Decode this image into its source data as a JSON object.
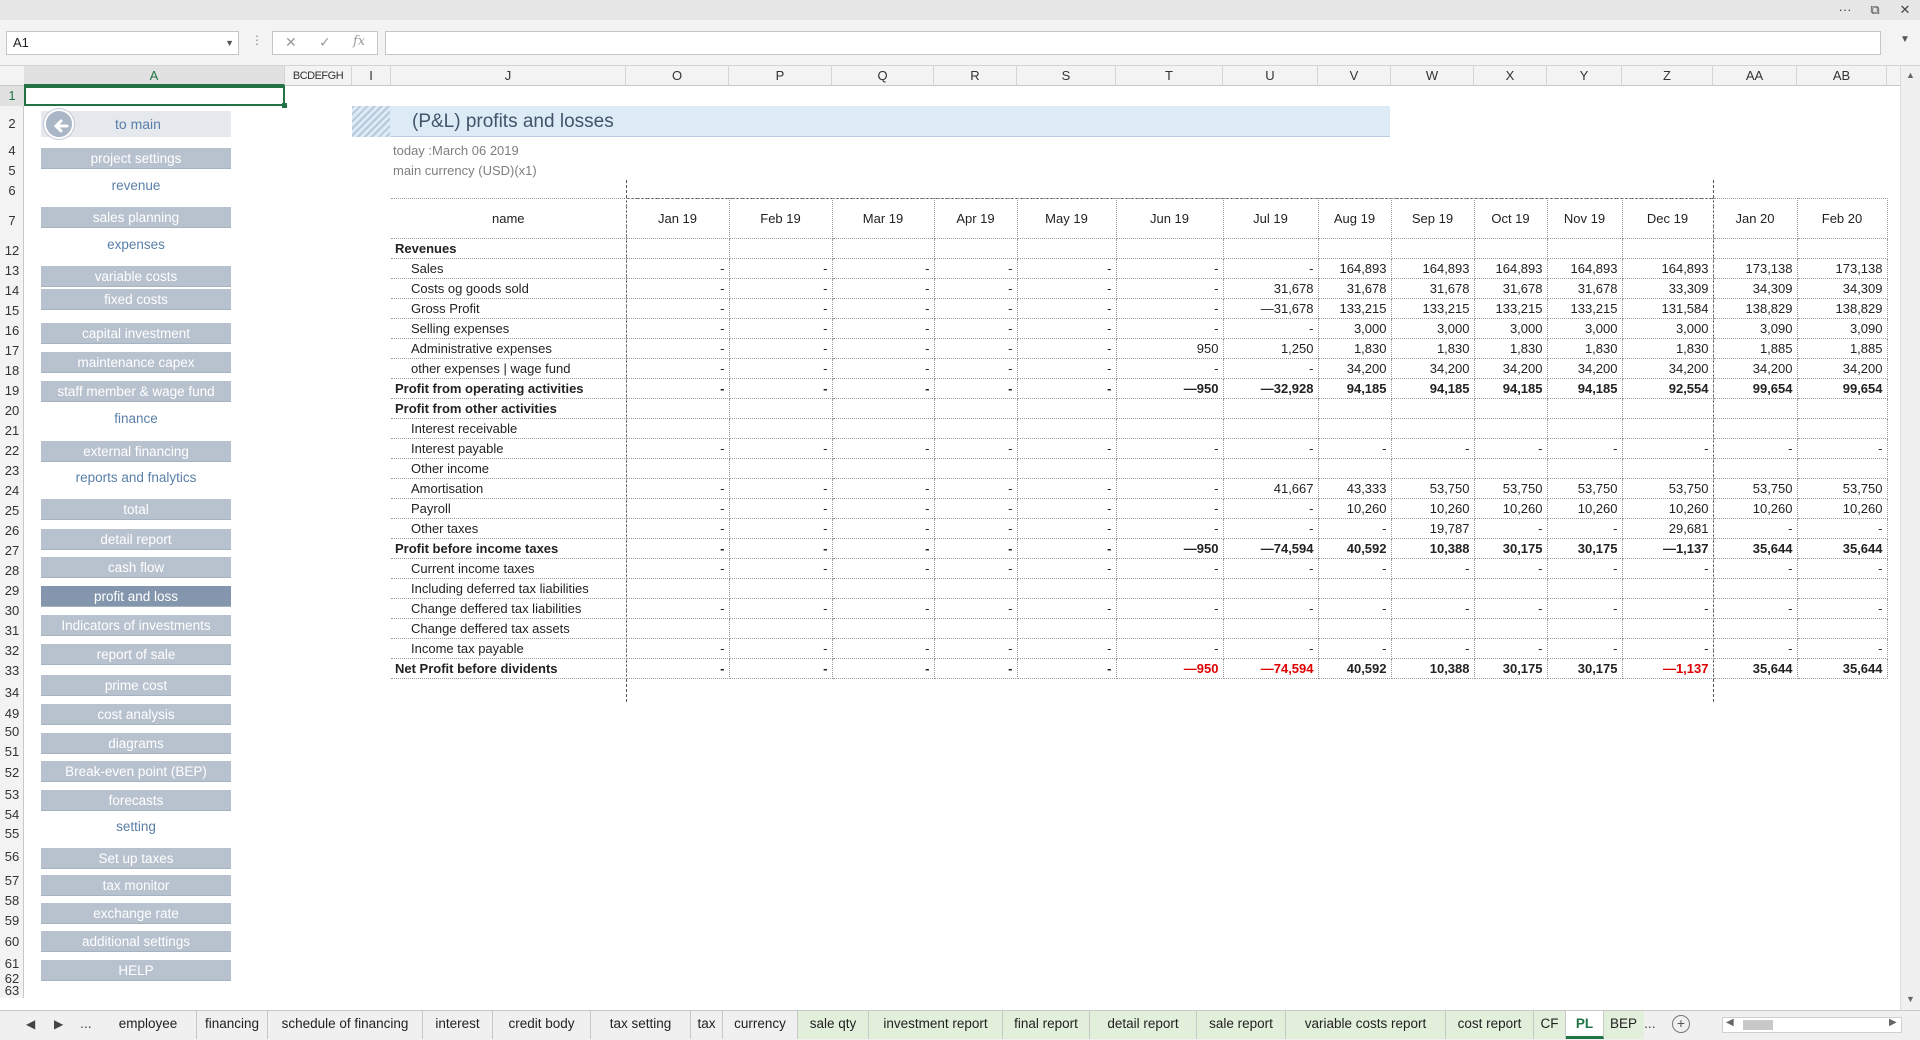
{
  "window": {
    "more": "···",
    "restore": "⧉",
    "close": "✕"
  },
  "formula_bar": {
    "name_box": "A1",
    "cancel": "✕",
    "enter": "✓",
    "fx": "fx",
    "value": ""
  },
  "columns": [
    "A",
    "BCDEFGH",
    "I",
    "J",
    "O",
    "P",
    "Q",
    "R",
    "S",
    "T",
    "U",
    "V",
    "W",
    "X",
    "Y",
    "Z",
    "AA",
    "AB"
  ],
  "rows": [
    "1",
    "2",
    "4",
    "5",
    "6",
    "7",
    "12",
    "13",
    "14",
    "15",
    "16",
    "17",
    "18",
    "19",
    "20",
    "21",
    "22",
    "23",
    "24",
    "25",
    "26",
    "27",
    "28",
    "29",
    "30",
    "31",
    "32",
    "33",
    "34",
    "49",
    "50",
    "51",
    "52",
    "53",
    "54",
    "55",
    "56",
    "57",
    "58",
    "59",
    "60",
    "61",
    "62",
    "63"
  ],
  "sidebar": {
    "to_main": "to main",
    "items": [
      {
        "type": "button",
        "label": "project settings"
      },
      {
        "type": "label",
        "label": "revenue"
      },
      {
        "type": "button",
        "label": "sales planning"
      },
      {
        "type": "label",
        "label": "expenses"
      },
      {
        "type": "button",
        "label": "variable costs"
      },
      {
        "type": "button",
        "label": "fixed costs"
      },
      {
        "type": "button",
        "label": "capital investment"
      },
      {
        "type": "button",
        "label": "maintenance capex"
      },
      {
        "type": "button",
        "label": "staff member & wage fund"
      },
      {
        "type": "label",
        "label": "finance"
      },
      {
        "type": "button",
        "label": "external financing"
      },
      {
        "type": "label",
        "label": "reports and fnalytics"
      },
      {
        "type": "button",
        "label": "total"
      },
      {
        "type": "button",
        "label": "detail report"
      },
      {
        "type": "button",
        "label": "cash flow"
      },
      {
        "type": "button",
        "label": "profit and loss",
        "active": true
      },
      {
        "type": "button",
        "label": "Indicators of investments"
      },
      {
        "type": "button",
        "label": "report of sale"
      },
      {
        "type": "button",
        "label": "prime cost"
      },
      {
        "type": "button",
        "label": "cost analysis"
      },
      {
        "type": "button",
        "label": "diagrams"
      },
      {
        "type": "button",
        "label": "Break-even point (BEP)"
      },
      {
        "type": "button",
        "label": "forecasts"
      },
      {
        "type": "label",
        "label": "setting"
      },
      {
        "type": "button",
        "label": "Set up taxes"
      },
      {
        "type": "button",
        "label": "tax monitor"
      },
      {
        "type": "button",
        "label": "exchange rate"
      },
      {
        "type": "button",
        "label": "additional settings"
      },
      {
        "type": "button",
        "label": "HELP"
      }
    ]
  },
  "report": {
    "title": "(P&L) profits and losses",
    "today": "today :March 06 2019",
    "currency": "main currency (USD)(x1)",
    "name_header": "name",
    "months": [
      "Jan 19",
      "Feb 19",
      "Mar 19",
      "Apr 19",
      "May 19",
      "Jun 19",
      "Jul 19",
      "Aug 19",
      "Sep 19",
      "Oct 19",
      "Nov 19",
      "Dec 19",
      "Jan 20",
      "Feb 20"
    ],
    "rows": [
      {
        "name": "Revenues",
        "style": "bold",
        "values": [
          "",
          "",
          "",
          "",
          "",
          "",
          "",
          "",
          "",
          "",
          "",
          "",
          "",
          ""
        ]
      },
      {
        "name": "Sales",
        "style": "indent",
        "values": [
          "-",
          "-",
          "-",
          "-",
          "-",
          "-",
          "-",
          "164,893",
          "164,893",
          "164,893",
          "164,893",
          "164,893",
          "173,138",
          "173,138"
        ]
      },
      {
        "name": "Costs og goods sold",
        "style": "indent",
        "values": [
          "-",
          "-",
          "-",
          "-",
          "-",
          "-",
          "31,678",
          "31,678",
          "31,678",
          "31,678",
          "31,678",
          "33,309",
          "34,309",
          "34,309"
        ]
      },
      {
        "name": "Gross Profit",
        "style": "indent",
        "values": [
          "-",
          "-",
          "-",
          "-",
          "-",
          "-",
          "—31,678",
          "133,215",
          "133,215",
          "133,215",
          "133,215",
          "131,584",
          "138,829",
          "138,829"
        ]
      },
      {
        "name": "Selling expenses",
        "style": "indent",
        "values": [
          "-",
          "-",
          "-",
          "-",
          "-",
          "-",
          "-",
          "3,000",
          "3,000",
          "3,000",
          "3,000",
          "3,000",
          "3,090",
          "3,090"
        ]
      },
      {
        "name": "Administrative expenses",
        "style": "indent",
        "values": [
          "-",
          "-",
          "-",
          "-",
          "-",
          "950",
          "1,250",
          "1,830",
          "1,830",
          "1,830",
          "1,830",
          "1,830",
          "1,885",
          "1,885"
        ]
      },
      {
        "name": "other expenses | wage fund",
        "style": "indent",
        "values": [
          "-",
          "-",
          "-",
          "-",
          "-",
          "-",
          "-",
          "34,200",
          "34,200",
          "34,200",
          "34,200",
          "34,200",
          "34,200",
          "34,200"
        ]
      },
      {
        "name": "Profit from operating activities",
        "style": "bold",
        "values": [
          "-",
          "-",
          "-",
          "-",
          "-",
          "—950",
          "—32,928",
          "94,185",
          "94,185",
          "94,185",
          "94,185",
          "92,554",
          "99,654",
          "99,654"
        ]
      },
      {
        "name": "Profit from other activities",
        "style": "bold",
        "values": [
          "",
          "",
          "",
          "",
          "",
          "",
          "",
          "",
          "",
          "",
          "",
          "",
          "",
          ""
        ]
      },
      {
        "name": "Interest receivable",
        "style": "indent",
        "values": [
          "",
          "",
          "",
          "",
          "",
          "",
          "",
          "",
          "",
          "",
          "",
          "",
          "",
          ""
        ]
      },
      {
        "name": "Interest payable",
        "style": "indent",
        "values": [
          "-",
          "-",
          "-",
          "-",
          "-",
          "-",
          "-",
          "-",
          "-",
          "-",
          "-",
          "-",
          "-",
          "-"
        ]
      },
      {
        "name": "Other income",
        "style": "indent",
        "values": [
          "",
          "",
          "",
          "",
          "",
          "",
          "",
          "",
          "",
          "",
          "",
          "",
          "",
          ""
        ]
      },
      {
        "name": "Amortisation",
        "style": "indent",
        "values": [
          "-",
          "-",
          "-",
          "-",
          "-",
          "-",
          "41,667",
          "43,333",
          "53,750",
          "53,750",
          "53,750",
          "53,750",
          "53,750",
          "53,750"
        ]
      },
      {
        "name": "Payroll",
        "style": "indent",
        "values": [
          "-",
          "-",
          "-",
          "-",
          "-",
          "-",
          "-",
          "10,260",
          "10,260",
          "10,260",
          "10,260",
          "10,260",
          "10,260",
          "10,260"
        ]
      },
      {
        "name": "Other taxes",
        "style": "indent",
        "values": [
          "-",
          "-",
          "-",
          "-",
          "-",
          "-",
          "-",
          "-",
          "19,787",
          "-",
          "-",
          "29,681",
          "-",
          "-"
        ]
      },
      {
        "name": "Profit before income taxes",
        "style": "bold",
        "values": [
          "-",
          "-",
          "-",
          "-",
          "-",
          "—950",
          "—74,594",
          "40,592",
          "10,388",
          "30,175",
          "30,175",
          "—1,137",
          "35,644",
          "35,644"
        ]
      },
      {
        "name": "Current income taxes",
        "style": "indent",
        "values": [
          "-",
          "-",
          "-",
          "-",
          "-",
          "-",
          "-",
          "-",
          "-",
          "-",
          "-",
          "-",
          "-",
          "-"
        ]
      },
      {
        "name": "Including deferred tax liabilities",
        "style": "indent",
        "values": [
          "",
          "",
          "",
          "",
          "",
          "",
          "",
          "",
          "",
          "",
          "",
          "",
          "",
          ""
        ]
      },
      {
        "name": "Change deffered tax liabilities",
        "style": "indent",
        "values": [
          "-",
          "-",
          "-",
          "-",
          "-",
          "-",
          "-",
          "-",
          "-",
          "-",
          "-",
          "-",
          "-",
          "-"
        ]
      },
      {
        "name": "Change deffered tax assets",
        "style": "indent",
        "values": [
          "",
          "",
          "",
          "",
          "",
          "",
          "",
          "",
          "",
          "",
          "",
          "",
          "",
          ""
        ]
      },
      {
        "name": "Income tax payable",
        "style": "indent",
        "values": [
          "-",
          "-",
          "-",
          "-",
          "-",
          "-",
          "-",
          "-",
          "-",
          "-",
          "-",
          "-",
          "-",
          "-"
        ]
      },
      {
        "name": "Net Profit before dividents",
        "style": "bold",
        "negative_red": true,
        "values": [
          "-",
          "-",
          "-",
          "-",
          "-",
          "—950",
          "—74,594",
          "40,592",
          "10,388",
          "30,175",
          "30,175",
          "—1,137",
          "35,644",
          "35,644"
        ]
      }
    ]
  },
  "sheet_tabs": {
    "prev": "◀",
    "next": "▶",
    "overflow_left": "...",
    "overflow_right": "...",
    "add": "+",
    "tabs": [
      {
        "label": "employee",
        "color": "none"
      },
      {
        "label": "financing",
        "color": "none"
      },
      {
        "label": "schedule of financing",
        "color": "none"
      },
      {
        "label": "interest",
        "color": "none"
      },
      {
        "label": "credit body",
        "color": "none"
      },
      {
        "label": "tax setting",
        "color": "none"
      },
      {
        "label": "tax",
        "color": "none"
      },
      {
        "label": "currency",
        "color": "none"
      },
      {
        "label": "sale qty",
        "color": "green"
      },
      {
        "label": "investment report",
        "color": "green"
      },
      {
        "label": "final report",
        "color": "green"
      },
      {
        "label": "detail report",
        "color": "green"
      },
      {
        "label": "sale report",
        "color": "green"
      },
      {
        "label": "variable costs report",
        "color": "green"
      },
      {
        "label": "cost report",
        "color": "green"
      },
      {
        "label": "CF",
        "color": "green"
      },
      {
        "label": "PL",
        "color": "active"
      },
      {
        "label": "BEP",
        "color": "green"
      }
    ]
  }
}
